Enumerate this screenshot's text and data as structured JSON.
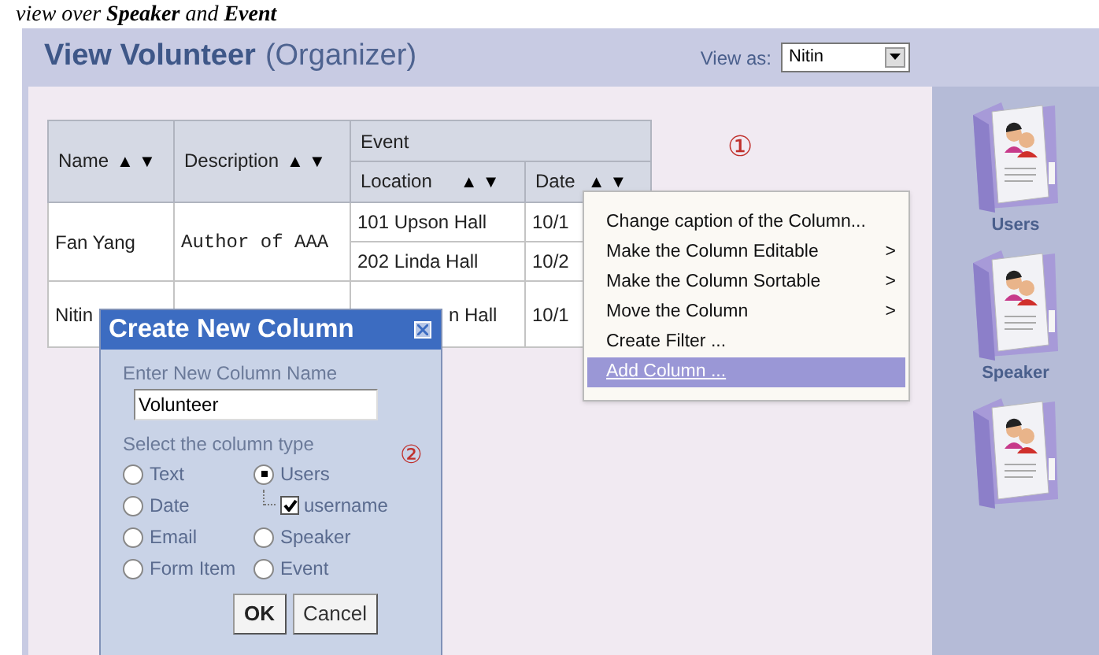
{
  "caption": "view over **Speaker** and **Event**",
  "header": {
    "title": "View Volunteer",
    "subtitle": "(Organizer)",
    "view_as_label": "View as:",
    "view_as_value": "Nitin"
  },
  "table": {
    "group_header": "Event",
    "columns": [
      {
        "label": "Name",
        "sort": "▲ ▼"
      },
      {
        "label": "Description",
        "sort": "▲ ▼"
      },
      {
        "label": "Location",
        "sort": "▲ ▼"
      },
      {
        "label": "Date",
        "sort": "▲ ▼"
      }
    ],
    "rows": [
      {
        "name": "Fan Yang",
        "description": "Author of AAA",
        "events": [
          {
            "location": "101 Upson Hall",
            "date": "10/1"
          },
          {
            "location": "202 Linda Hall",
            "date": "10/2"
          }
        ]
      },
      {
        "name": "Nitin",
        "events": [
          {
            "location": "n Hall",
            "date": "10/1"
          }
        ]
      }
    ]
  },
  "markers": [
    "①",
    "②"
  ],
  "context_menu": [
    {
      "label": "Change caption of the Column...",
      "selected": false
    },
    {
      "label": "Make the Column Editable",
      "submenu": ">",
      "selected": false
    },
    {
      "label": "Make the Column Sortable",
      "submenu": ">",
      "selected": false
    },
    {
      "label": "Move the Column",
      "submenu": ">",
      "selected": false
    },
    {
      "label": "Create Filter ...",
      "selected": false
    },
    {
      "label": "Add Column ...",
      "selected": true
    }
  ],
  "dialog": {
    "title": "Create New Column",
    "name_label": "Enter New Column Name",
    "name_value": "Volunteer",
    "type_label": "Select the column type",
    "type_columns": [
      [
        {
          "label": "Text",
          "selected": false
        },
        {
          "label": "Date",
          "selected": false
        },
        {
          "label": "Email",
          "selected": false
        },
        {
          "label": "Form Item",
          "selected": false
        }
      ],
      [
        {
          "label": "Users",
          "selected": true,
          "children": [
            {
              "label": "username",
              "checked": true
            }
          ]
        },
        {
          "label": "Speaker",
          "selected": false
        },
        {
          "label": "Event",
          "selected": false
        }
      ]
    ],
    "buttons": [
      "OK",
      "Cancel"
    ]
  },
  "sidebar": [
    {
      "label": "Users"
    },
    {
      "label": "Speaker"
    }
  ]
}
